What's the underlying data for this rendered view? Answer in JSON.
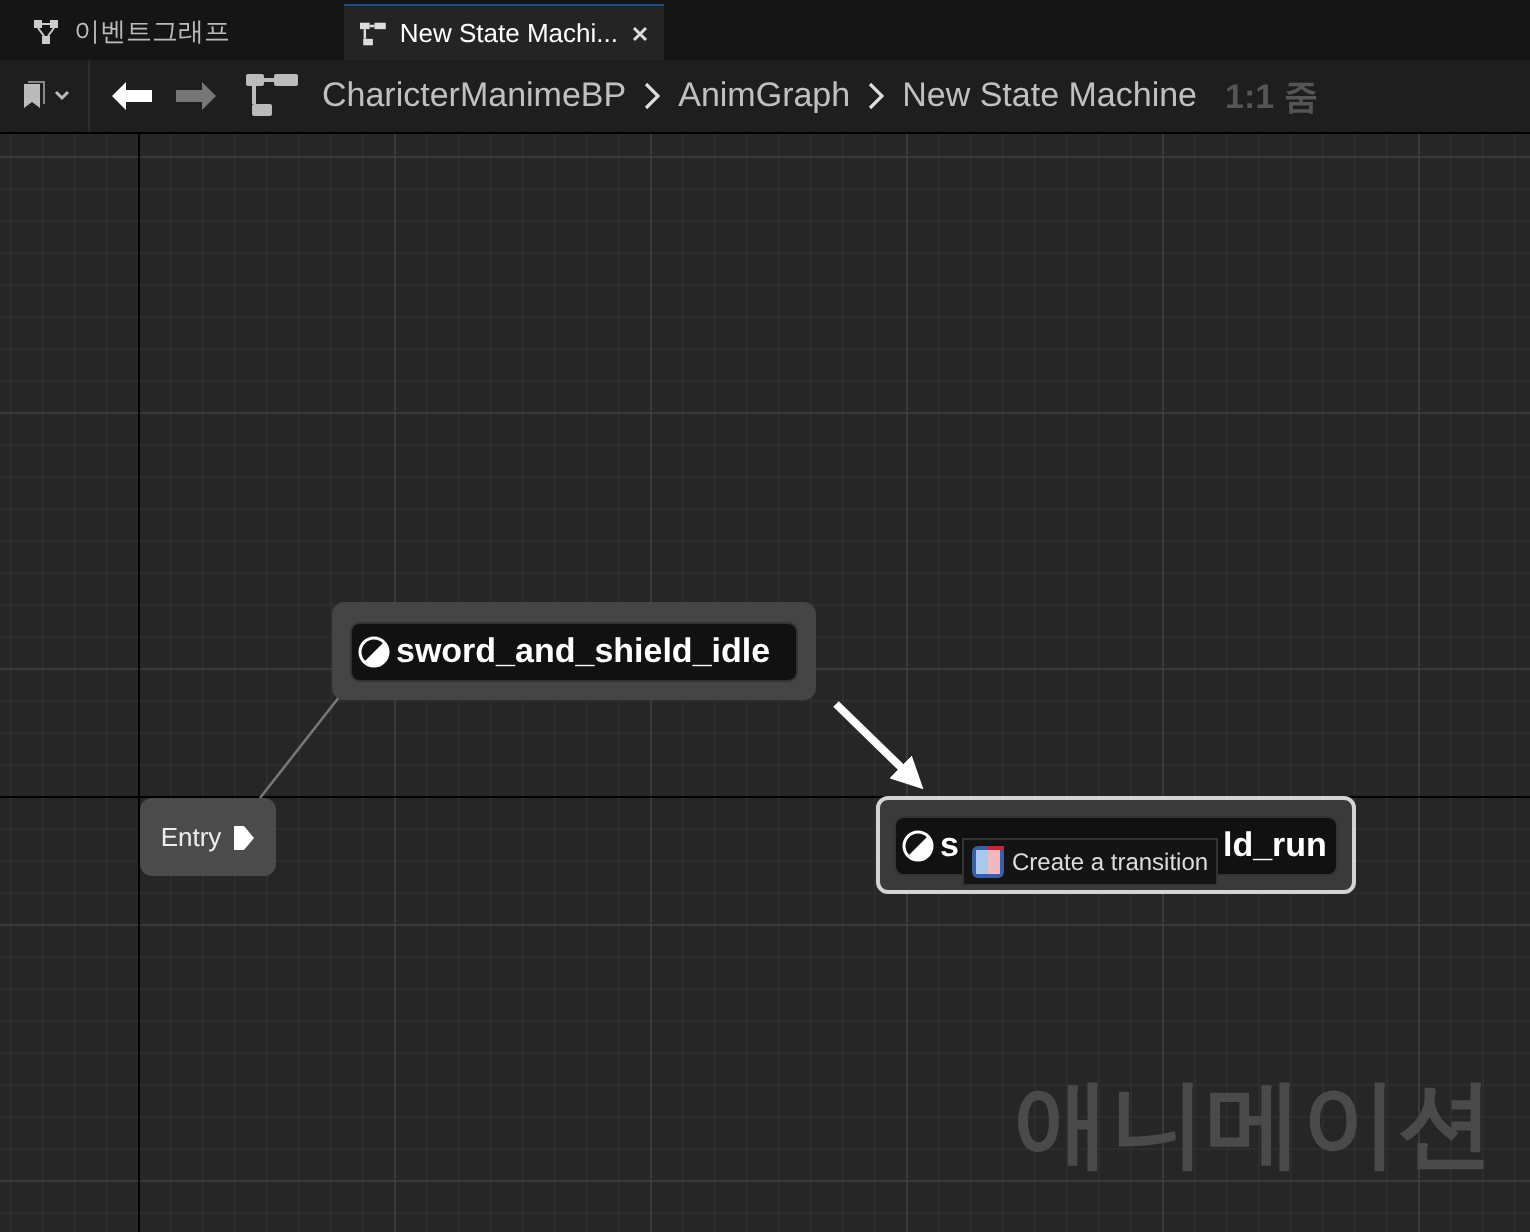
{
  "tabs": [
    {
      "label": "이벤트그래프",
      "kind": "graph",
      "selected": false
    },
    {
      "label": "New State Machi...",
      "kind": "state-machine",
      "selected": true
    }
  ],
  "toolbar": {
    "breadcrumbs": [
      "CharicterManimeBP",
      "AnimGraph",
      "New State Machine"
    ],
    "zoom": "1:1 줌"
  },
  "graph": {
    "entry": {
      "label": "Entry"
    },
    "states": [
      {
        "title_parts": [
          "sword_and_shield_idle"
        ],
        "selected": false
      },
      {
        "title_parts": [
          "s",
          "ld_run"
        ],
        "selected": true
      }
    ],
    "tooltip": {
      "text": "Create a transition"
    },
    "watermark": "애니메이션"
  }
}
